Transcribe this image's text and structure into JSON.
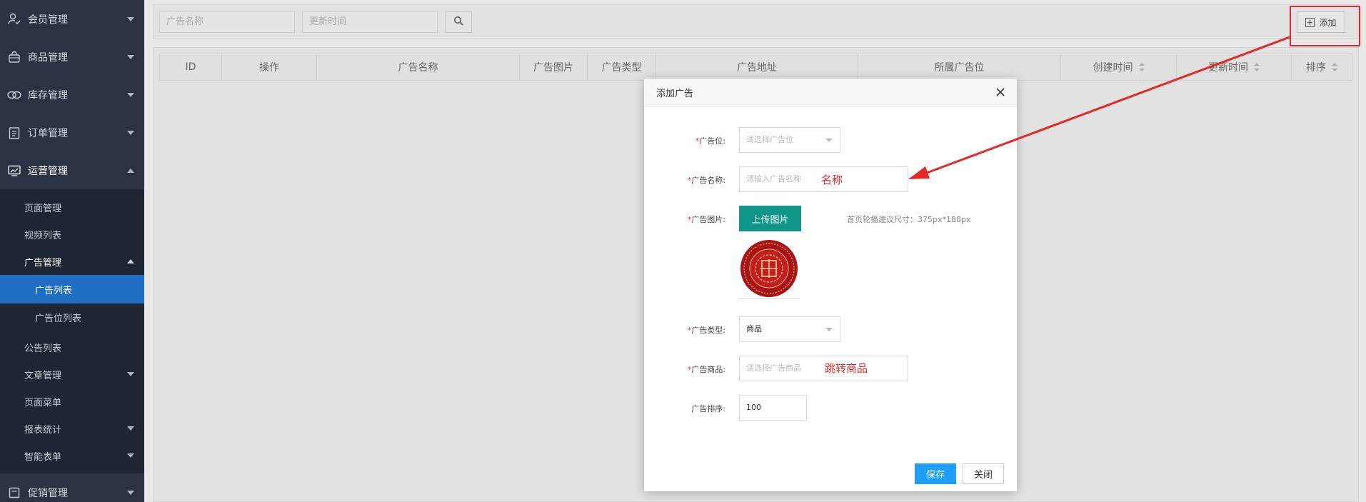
{
  "sidebar": {
    "items": [
      {
        "label": "会员管理",
        "icon": "user-check-icon"
      },
      {
        "label": "商品管理",
        "icon": "shopping-bag-icon"
      },
      {
        "label": "库存管理",
        "icon": "link-icon"
      },
      {
        "label": "订单管理",
        "icon": "clipboard-icon"
      },
      {
        "label": "运营管理",
        "icon": "chart-line-icon"
      }
    ],
    "sub": {
      "page_manage": "页面管理",
      "video_list": "视频列表",
      "ad_manage": "广告管理",
      "ad_list": "广告列表",
      "ad_slot_list": "广告位列表",
      "notice_list": "公告列表",
      "article_manage": "文章管理",
      "page_menu": "页面菜单",
      "report_stats": "报表统计",
      "smart_form": "智能表单"
    },
    "bottom_item": {
      "label": "促销管理",
      "icon": "promo-icon"
    }
  },
  "toolbar": {
    "ad_name_placeholder": "广告名称",
    "update_time_placeholder": "更新时间",
    "add_label": "添加"
  },
  "table": {
    "columns": [
      "ID",
      "操作",
      "广告名称",
      "广告图片",
      "广告类型",
      "广告地址",
      "所属广告位",
      "创建时间",
      "更新时间",
      "排序"
    ]
  },
  "dialog": {
    "title": "添加广告",
    "fields": {
      "ad_slot": {
        "label": "广告位:",
        "placeholder": "请选择广告位"
      },
      "ad_name": {
        "label": "广告名称:",
        "placeholder": "请输入广告名称",
        "note": "名称"
      },
      "ad_image": {
        "label": "广告图片:",
        "upload": "上传图片",
        "hint": "首页轮播建议尺寸：375px*188px"
      },
      "ad_type": {
        "label": "广告类型:",
        "value": "商品"
      },
      "ad_goods": {
        "label": "广告商品:",
        "placeholder": "请选择广告商品",
        "note": "跳转商品"
      },
      "ad_sort": {
        "label": "广告排序:",
        "value": "100"
      }
    },
    "save_label": "保存",
    "close_label": "关闭"
  },
  "colors": {
    "sidebar_bg": "#2b3342",
    "active_blue": "#1e6fc3",
    "upload_green": "#0f9688",
    "save_blue": "#1e9fff",
    "annotation_red": "#e32a2a"
  }
}
